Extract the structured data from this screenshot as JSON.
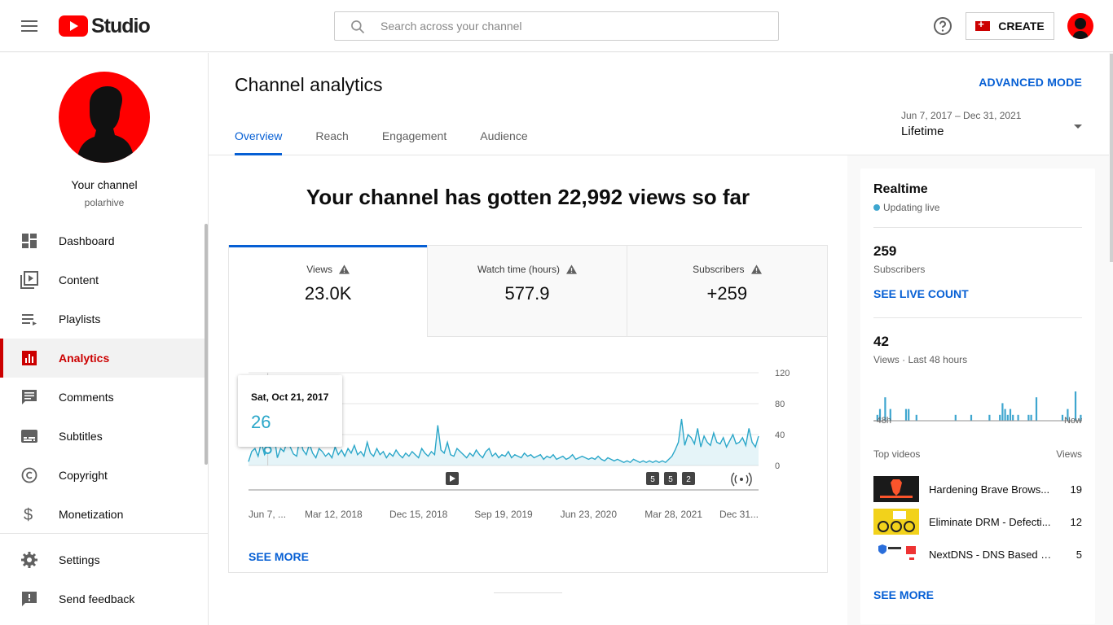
{
  "header": {
    "logo_text": "Studio",
    "search_placeholder": "Search across your channel",
    "create_label": "CREATE"
  },
  "sidebar": {
    "channel_label": "Your channel",
    "channel_handle": "polarhive",
    "items": [
      {
        "label": "Dashboard",
        "icon": "dashboard-icon"
      },
      {
        "label": "Content",
        "icon": "content-icon"
      },
      {
        "label": "Playlists",
        "icon": "playlists-icon"
      },
      {
        "label": "Analytics",
        "icon": "analytics-icon",
        "active": true
      },
      {
        "label": "Comments",
        "icon": "comments-icon"
      },
      {
        "label": "Subtitles",
        "icon": "subtitles-icon"
      },
      {
        "label": "Copyright",
        "icon": "copyright-icon"
      },
      {
        "label": "Monetization",
        "icon": "monetization-icon"
      }
    ],
    "bottom_items": [
      {
        "label": "Settings",
        "icon": "settings-icon"
      },
      {
        "label": "Send feedback",
        "icon": "feedback-icon"
      }
    ]
  },
  "main": {
    "title": "Channel analytics",
    "advanced_mode": "ADVANCED MODE",
    "tabs": [
      "Overview",
      "Reach",
      "Engagement",
      "Audience"
    ],
    "active_tab": "Overview",
    "date_range_label": "Jun 7, 2017 – Dec 31, 2021",
    "date_range_value": "Lifetime",
    "headline": "Your channel has gotten 22,992 views so far",
    "metrics": [
      {
        "label": "Views",
        "value": "23.0K"
      },
      {
        "label": "Watch time (hours)",
        "value": "577.9"
      },
      {
        "label": "Subscribers",
        "value": "+259"
      }
    ],
    "tooltip": {
      "date": "Sat, Oct 21, 2017",
      "value": "26"
    },
    "see_more": "SEE MORE"
  },
  "chart_data": {
    "type": "line",
    "series": [
      {
        "values": [
          5,
          18,
          22,
          12,
          30,
          14,
          20,
          26,
          38,
          10,
          22,
          18,
          30,
          24,
          15,
          12,
          36,
          20,
          14,
          28,
          16,
          10,
          22,
          18,
          12,
          16,
          10,
          24,
          14,
          20,
          12,
          22,
          16,
          26,
          14,
          18,
          12,
          30,
          16,
          12,
          22,
          14,
          18,
          10,
          16,
          12,
          20,
          14,
          10,
          16,
          12,
          18,
          14,
          10,
          22,
          16,
          12,
          18,
          14,
          52,
          20,
          16,
          30,
          14,
          12,
          22,
          18,
          14,
          10,
          16,
          12,
          20,
          14,
          10,
          18,
          22,
          12,
          16,
          10,
          14,
          12,
          18,
          10,
          14,
          12,
          10,
          16,
          12,
          14,
          10,
          12,
          14,
          8,
          12,
          10,
          14,
          8,
          10,
          12,
          8,
          10,
          14,
          8,
          10,
          12,
          10,
          8,
          10,
          8,
          12,
          8,
          6,
          10,
          8,
          6,
          8,
          6,
          4,
          6,
          4,
          8,
          6,
          4,
          6,
          4,
          6,
          4,
          6,
          4,
          6,
          4,
          8,
          12,
          20,
          30,
          60,
          26,
          40,
          36,
          28,
          48,
          24,
          38,
          30,
          26,
          42,
          30,
          28,
          36,
          24,
          32,
          40,
          28,
          30,
          36,
          26,
          48,
          30,
          24,
          38
        ]
      }
    ],
    "y_ticks": [
      "120",
      "80",
      "40",
      "0"
    ],
    "ylim": [
      0,
      120
    ],
    "x_ticks": [
      "Jun 7, ...",
      "Mar 12, 2018",
      "Dec 15, 2018",
      "Sep 19, 2019",
      "Jun 23, 2020",
      "Mar 28, 2021",
      "Dec 31..."
    ],
    "markers": [
      "5",
      "5",
      "2"
    ],
    "grid": true
  },
  "realtime": {
    "title": "Realtime",
    "status": "Updating live",
    "subscribers_value": "259",
    "subscribers_label": "Subscribers",
    "live_count_link": "SEE LIVE COUNT",
    "views_value": "42",
    "views_label": "Views · Last 48 hours",
    "axis_start": "-48h",
    "axis_end": "Now",
    "bars": [
      0,
      1,
      2,
      0,
      4,
      0,
      2,
      0,
      0,
      0,
      0,
      0,
      2,
      2,
      0,
      0,
      1,
      0,
      0,
      0,
      0,
      0,
      0,
      0,
      0,
      0,
      0,
      0,
      0,
      0,
      0,
      1,
      0,
      0,
      0,
      0,
      0,
      1,
      0,
      0,
      0,
      0,
      0,
      0,
      1,
      0,
      0,
      0,
      1,
      3,
      2,
      1,
      2,
      1,
      0,
      1,
      0,
      0,
      0,
      1,
      1,
      0,
      4,
      0,
      0,
      0,
      0,
      0,
      0,
      0,
      0,
      0,
      1,
      0,
      2,
      0,
      0,
      5,
      0,
      1
    ],
    "top_videos_label": "Top videos",
    "views_col_label": "Views",
    "videos": [
      {
        "title": "Hardening Brave Brows...",
        "views": "19"
      },
      {
        "title": "Eliminate DRM - Defecti...",
        "views": "12"
      },
      {
        "title": "NextDNS - DNS Based Fir...",
        "views": "5"
      }
    ],
    "see_more": "SEE MORE"
  },
  "colors": {
    "accent": "#065fd4",
    "brand": "#ff0000",
    "chart": "#2ba7c9",
    "active_nav": "#cc0000"
  }
}
